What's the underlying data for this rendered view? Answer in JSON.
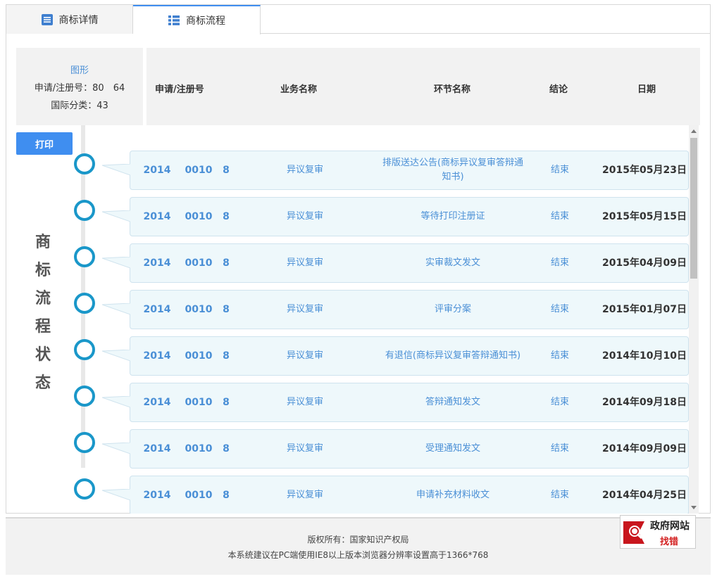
{
  "tabs": [
    {
      "label": "商标详情",
      "icon": "list-icon"
    },
    {
      "label": "商标流程",
      "icon": "grid-icon",
      "active": true
    }
  ],
  "info": {
    "figure_label": "图形",
    "reg_line": "申请/注册号：80　64",
    "class_line": "国际分类：43"
  },
  "table_headers": {
    "reg_no": "申请/注册号",
    "business": "业务名称",
    "step": "环节名称",
    "result": "结论",
    "date": "日期"
  },
  "print_label": "打印",
  "vertical_title": [
    "商",
    "标",
    "流",
    "程",
    "状",
    "态"
  ],
  "rows": [
    {
      "n1": "2014",
      "n2": "0010",
      "n3": "8",
      "business": "异议复审",
      "step": "排版送达公告(商标异议复审答辩通知书)",
      "result": "结束",
      "date": "2015年05月23日"
    },
    {
      "n1": "2014",
      "n2": "0010",
      "n3": "8",
      "business": "异议复审",
      "step": "等待打印注册证",
      "result": "结束",
      "date": "2015年05月15日"
    },
    {
      "n1": "2014",
      "n2": "0010",
      "n3": "8",
      "business": "异议复审",
      "step": "实审裁文发文",
      "result": "结束",
      "date": "2015年04月09日"
    },
    {
      "n1": "2014",
      "n2": "0010",
      "n3": "8",
      "business": "异议复审",
      "step": "评审分案",
      "result": "结束",
      "date": "2015年01月07日"
    },
    {
      "n1": "2014",
      "n2": "0010",
      "n3": "8",
      "business": "异议复审",
      "step": "有退信(商标异议复审答辩通知书)",
      "result": "结束",
      "date": "2014年10月10日"
    },
    {
      "n1": "2014",
      "n2": "0010",
      "n3": "8",
      "business": "异议复审",
      "step": "答辩通知发文",
      "result": "结束",
      "date": "2014年09月18日"
    },
    {
      "n1": "2014",
      "n2": "0010",
      "n3": "8",
      "business": "异议复审",
      "step": "受理通知发文",
      "result": "结束",
      "date": "2014年09月09日"
    },
    {
      "n1": "2014",
      "n2": "0010",
      "n3": "8",
      "business": "异议复审",
      "step": "申请补充材料收文",
      "result": "结束",
      "date": "2014年04月25日"
    }
  ],
  "footer": {
    "line1": "版权所有：国家知识产权局",
    "line2": "本系统建议在PC端使用IE8以上版本浏览器分辨率设置高于1366*768"
  },
  "badge": {
    "line1": "政府网站",
    "line2": "找错"
  }
}
